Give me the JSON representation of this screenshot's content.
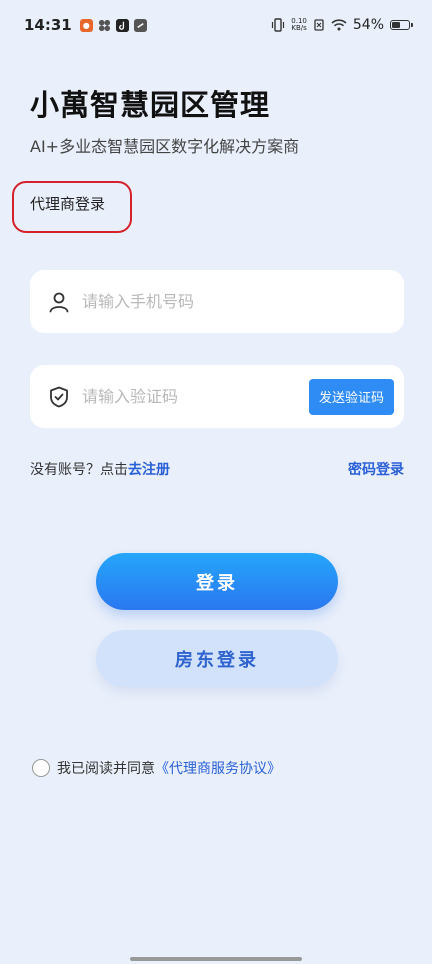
{
  "status_bar": {
    "time": "14:31",
    "net_speed_value": "0.10",
    "net_speed_unit": "KB/s",
    "battery_percent": "54%",
    "battery_level": 0.54
  },
  "header": {
    "app_title": "小萬智慧园区管理",
    "subtitle": "AI+多业态智慧园区数字化解决方案商",
    "role_label": "代理商登录"
  },
  "form": {
    "phone": {
      "value": "",
      "placeholder": "请输入手机号码"
    },
    "code": {
      "value": "",
      "placeholder": "请输入验证码"
    },
    "send_code_label": "发送验证码"
  },
  "links": {
    "no_account_prefix": "没有账号？点击",
    "register_label": "去注册",
    "password_login_label": "密码登录"
  },
  "buttons": {
    "login_label": "登录",
    "landlord_login_label": "房东登录"
  },
  "agreement": {
    "checked": false,
    "prefix": "我已阅读并同意",
    "link_label": "《代理商服务协议》"
  },
  "colors": {
    "background": "#eaf0fb",
    "accent": "#2f8cf4",
    "link": "#2960d6",
    "annotation": "#d4212a"
  }
}
